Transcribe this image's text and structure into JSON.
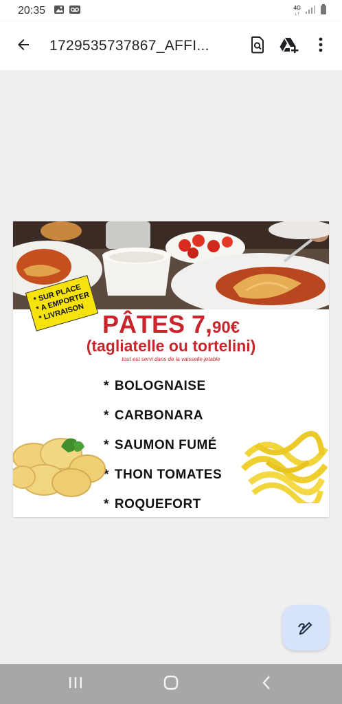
{
  "status_bar": {
    "time": "20:35",
    "network_type": "4G",
    "icons": [
      "image-icon",
      "voicemail-icon",
      "signal-icon",
      "battery-icon"
    ]
  },
  "app_bar": {
    "title": "1729535737867_AFFI...",
    "icons": [
      "back-arrow-icon",
      "search-in-document-icon",
      "drive-add-icon",
      "more-vert-icon"
    ]
  },
  "poster": {
    "badge_lines": [
      "* SUR PLACE",
      "* A EMPORTER",
      "* LIVRAISON"
    ],
    "headline_word": "PÂTES",
    "price_main": "7,",
    "price_cents": "90€",
    "subtitle": "(tagliatelle ou tortelini)",
    "note": "tout est servi dans de la vaisselle jetable",
    "menu_items": [
      "BOLOGNAISE",
      "CARBONARA",
      "SAUMON FUMÉ",
      "THON TOMATES",
      "ROQUEFORT"
    ],
    "star": "*",
    "colors": {
      "headline": "#c8252c",
      "badge": "#f6e20d"
    }
  },
  "fab": {
    "icon": "edit-pen-icon"
  },
  "nav_bar": {
    "icons": [
      "recent-apps-icon",
      "home-icon",
      "back-icon"
    ]
  }
}
